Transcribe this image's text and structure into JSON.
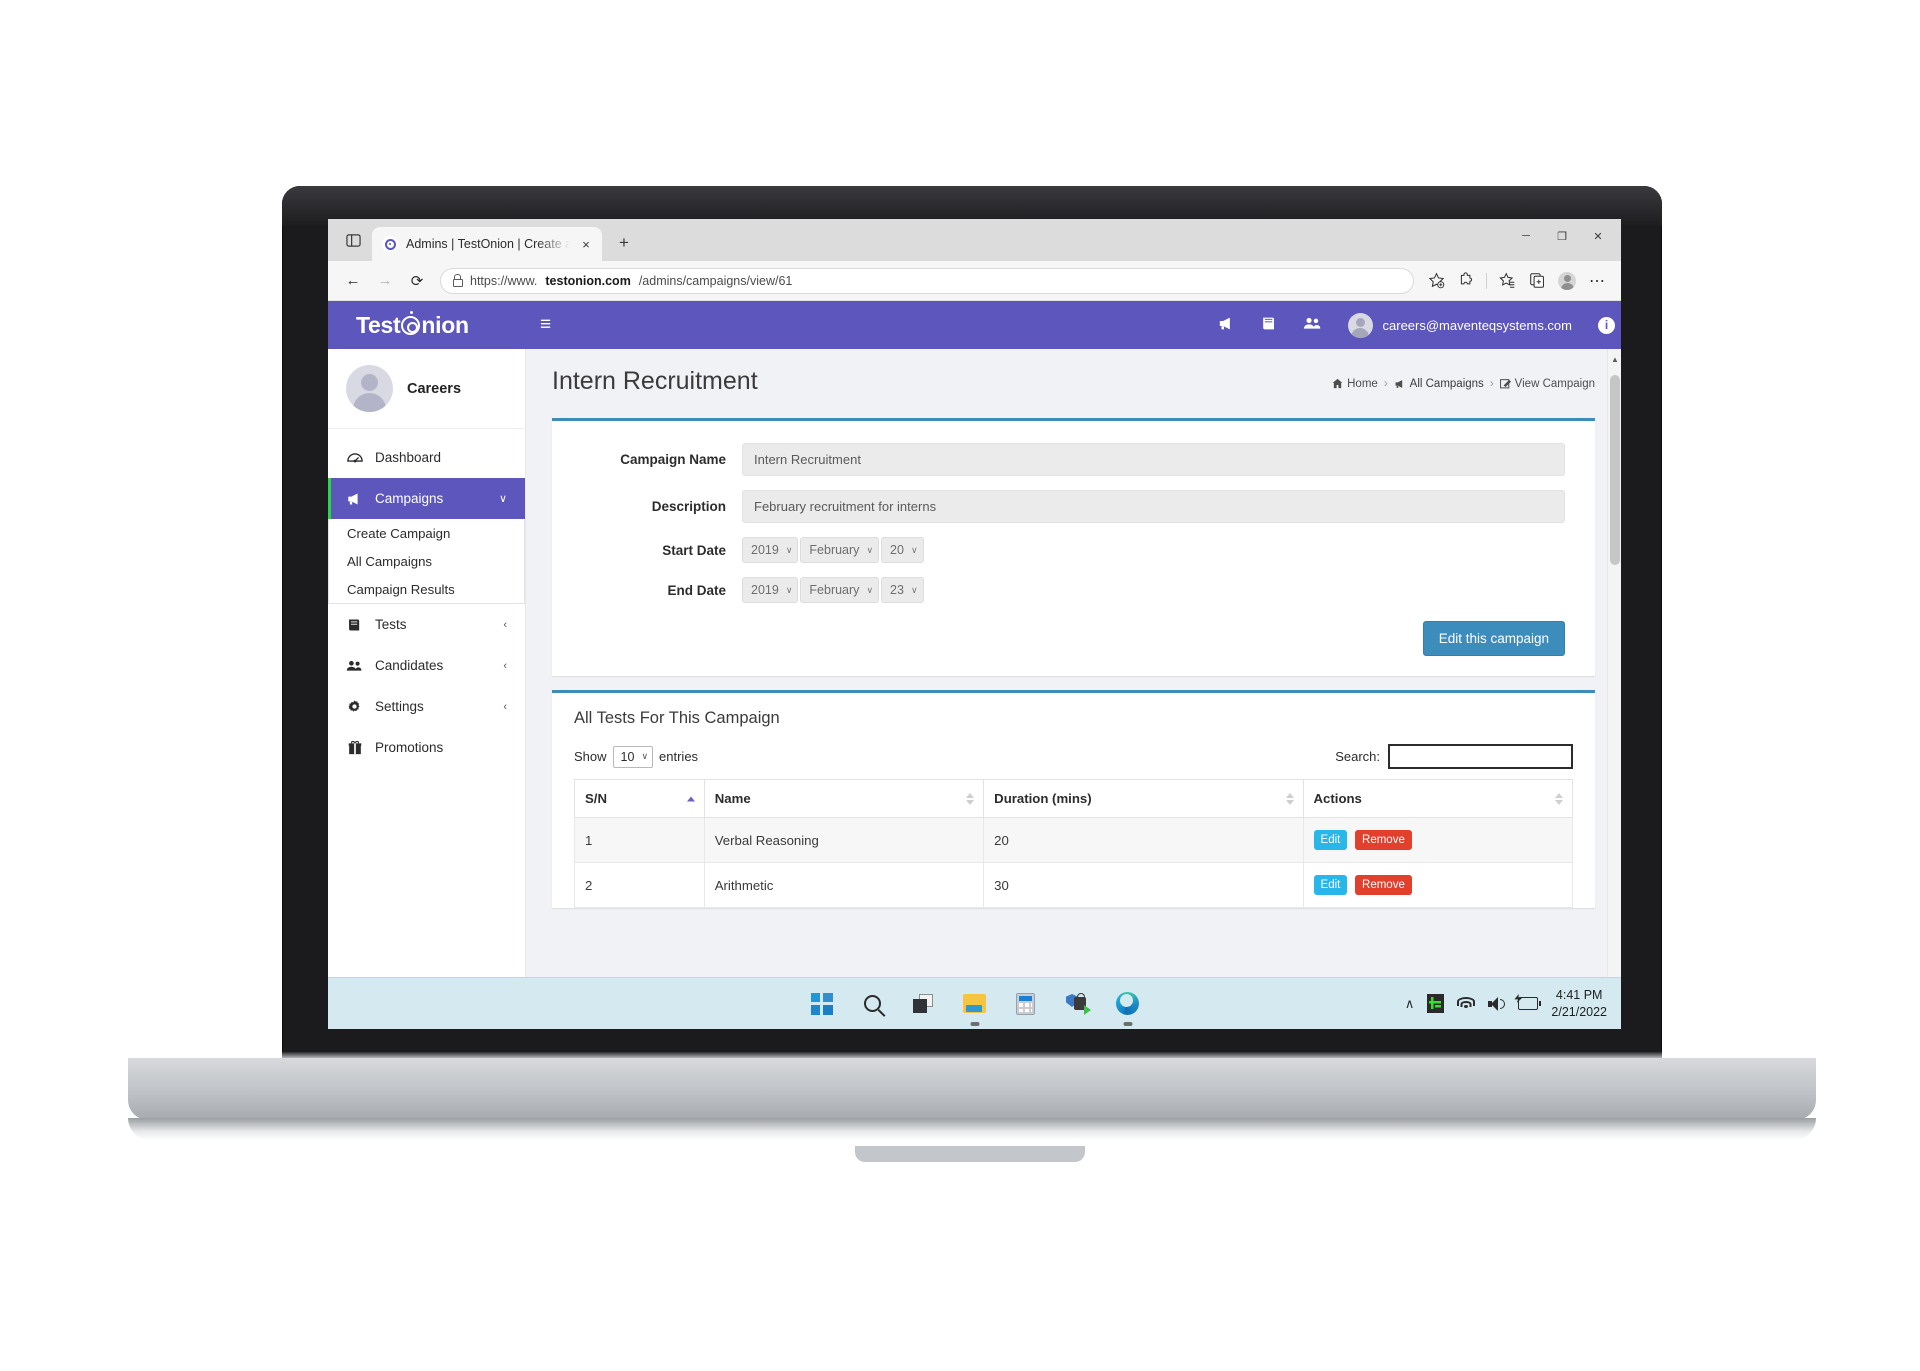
{
  "browser": {
    "tab_title": "Admins | TestOnion | Create and",
    "new_tab_label": "+",
    "close_tab_label": "×",
    "minimize_label": "─",
    "maximize_label": "❐",
    "close_label": "✕",
    "back_label": "←",
    "forward_label": "→",
    "reload_label": "⟳",
    "url_scheme": "https://www.",
    "url_domain": "testonion.com",
    "url_path": "/admins/campaigns/view/61",
    "full_url": "https://www.testonion.com/admins/campaigns/view/61",
    "more_label": "⋯"
  },
  "app_header": {
    "brand_part1": "Test",
    "brand_part2": "nion",
    "hamburger": "≡",
    "user_email": "careers@maventeqsystems.com",
    "info_label": "i"
  },
  "sidebar": {
    "profile_name": "Careers",
    "items": [
      {
        "label": "Dashboard",
        "icon": "dashboard-icon",
        "glyph": "☸",
        "chevron": "",
        "active": false
      },
      {
        "label": "Campaigns",
        "icon": "megaphone-icon",
        "glyph": "📢",
        "chevron": "∨",
        "active": true
      },
      {
        "label": "Tests",
        "icon": "book-icon",
        "glyph": "📕",
        "chevron": "‹",
        "active": false
      },
      {
        "label": "Candidates",
        "icon": "users-icon",
        "glyph": "👥",
        "chevron": "‹",
        "active": false
      },
      {
        "label": "Settings",
        "icon": "gear-icon",
        "glyph": "⚙",
        "chevron": "‹",
        "active": false
      },
      {
        "label": "Promotions",
        "icon": "gift-icon",
        "glyph": "🎁",
        "chevron": "",
        "active": false
      }
    ],
    "submenu": [
      {
        "label": "Create Campaign"
      },
      {
        "label": "All Campaigns"
      },
      {
        "label": "Campaign Results"
      }
    ]
  },
  "page": {
    "title": "Intern Recruitment",
    "breadcrumb": [
      {
        "label": "Home",
        "icon": "home-icon"
      },
      {
        "label": "All Campaigns",
        "icon": "megaphone-icon"
      },
      {
        "label": "View Campaign",
        "icon": "edit-icon"
      }
    ],
    "breadcrumb_separator": "›"
  },
  "form": {
    "fields": [
      {
        "label": "Campaign Name",
        "value": "Intern Recruitment"
      },
      {
        "label": "Description",
        "value": "February recruitment for interns"
      }
    ],
    "dates": [
      {
        "label": "Start Date",
        "year": "2019",
        "month": "February",
        "day": "20"
      },
      {
        "label": "End Date",
        "year": "2019",
        "month": "February",
        "day": "23"
      }
    ],
    "caret": "∨",
    "edit_button": "Edit this campaign"
  },
  "tests_card": {
    "title": "All Tests For This Campaign",
    "show_prefix": "Show",
    "show_value": "10",
    "show_suffix": "entries",
    "search_label": "Search:",
    "search_value": "",
    "columns": [
      "S/N",
      "Name",
      "Duration (mins)",
      "Actions"
    ],
    "rows": [
      {
        "sn": "1",
        "name": "Verbal Reasoning",
        "duration": "20",
        "edit": "Edit",
        "remove": "Remove"
      },
      {
        "sn": "2",
        "name": "Arithmetic",
        "duration": "30",
        "edit": "Edit",
        "remove": "Remove"
      }
    ],
    "action_edit_color": "#29b6e8",
    "action_remove_color": "#e2402c"
  },
  "taskbar": {
    "apps": [
      {
        "name": "start-button"
      },
      {
        "name": "search-icon"
      },
      {
        "name": "task-view-icon"
      },
      {
        "name": "file-explorer-icon"
      },
      {
        "name": "calculator-icon"
      },
      {
        "name": "security-app-icon"
      },
      {
        "name": "edge-browser-icon"
      }
    ],
    "tray_expand": "∧",
    "time": "4:41 PM",
    "date": "2/21/2022"
  },
  "theme": {
    "brand_purple": "#5c56bd",
    "accent_blue": "#3c8dbc",
    "active_green": "#2bd44a",
    "taskbar_blue": "#d4eaf0"
  }
}
